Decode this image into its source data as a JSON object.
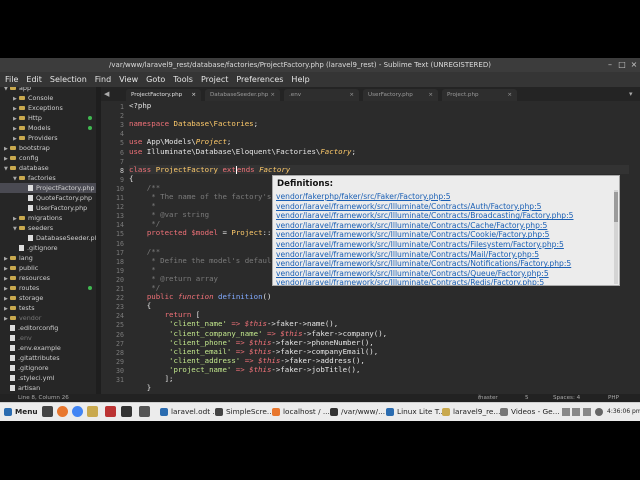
{
  "window": {
    "title": "/var/www/laravel9_rest/database/factories/ProjectFactory.php (laravel9_rest) - Sublime Text (UNREGISTERED)"
  },
  "menu": [
    "File",
    "Edit",
    "Selection",
    "Find",
    "View",
    "Goto",
    "Tools",
    "Project",
    "Preferences",
    "Help"
  ],
  "sidebar": {
    "items": [
      {
        "label": "app",
        "type": "folder",
        "depth": 1,
        "open": true
      },
      {
        "label": "Console",
        "type": "folder",
        "depth": 2,
        "open": false
      },
      {
        "label": "Exceptions",
        "type": "folder",
        "depth": 2,
        "open": false
      },
      {
        "label": "Http",
        "type": "folder",
        "depth": 2,
        "open": false,
        "dot": true
      },
      {
        "label": "Models",
        "type": "folder",
        "depth": 2,
        "open": false,
        "dot": true
      },
      {
        "label": "Providers",
        "type": "folder",
        "depth": 2,
        "open": false
      },
      {
        "label": "bootstrap",
        "type": "folder",
        "depth": 1,
        "open": false
      },
      {
        "label": "config",
        "type": "folder",
        "depth": 1,
        "open": false
      },
      {
        "label": "database",
        "type": "folder",
        "depth": 1,
        "open": true
      },
      {
        "label": "factories",
        "type": "folder",
        "depth": 2,
        "open": true
      },
      {
        "label": "ProjectFactory.php",
        "type": "file",
        "depth": 3,
        "active": true
      },
      {
        "label": "QuoteFactory.php",
        "type": "file",
        "depth": 3
      },
      {
        "label": "UserFactory.php",
        "type": "file",
        "depth": 3
      },
      {
        "label": "migrations",
        "type": "folder",
        "depth": 2,
        "open": false
      },
      {
        "label": "seeders",
        "type": "folder",
        "depth": 2,
        "open": true
      },
      {
        "label": "DatabaseSeeder.pl",
        "type": "file",
        "depth": 3
      },
      {
        "label": ".gitignore",
        "type": "file",
        "depth": 2
      },
      {
        "label": "lang",
        "type": "folder",
        "depth": 1,
        "open": false
      },
      {
        "label": "public",
        "type": "folder",
        "depth": 1,
        "open": false
      },
      {
        "label": "resources",
        "type": "folder",
        "depth": 1,
        "open": false
      },
      {
        "label": "routes",
        "type": "folder",
        "depth": 1,
        "open": false,
        "dot": true
      },
      {
        "label": "storage",
        "type": "folder",
        "depth": 1,
        "open": false
      },
      {
        "label": "tests",
        "type": "folder",
        "depth": 1,
        "open": false
      },
      {
        "label": "vendor",
        "type": "folder",
        "depth": 1,
        "open": false,
        "dim": true
      },
      {
        "label": ".editorconfig",
        "type": "file",
        "depth": 1
      },
      {
        "label": ".env",
        "type": "file",
        "depth": 1,
        "dim": true
      },
      {
        "label": ".env.example",
        "type": "file",
        "depth": 1
      },
      {
        "label": ".gitattributes",
        "type": "file",
        "depth": 1
      },
      {
        "label": ".gitignore",
        "type": "file",
        "depth": 1
      },
      {
        "label": ".styleci.yml",
        "type": "file",
        "depth": 1
      },
      {
        "label": "artisan",
        "type": "file",
        "depth": 1
      }
    ]
  },
  "tabs": [
    {
      "label": "ProjectFactory.php",
      "active": true
    },
    {
      "label": "DatabaseSeeder.php",
      "active": false
    },
    {
      "label": ".env",
      "active": false
    },
    {
      "label": "UserFactory.php",
      "active": false
    },
    {
      "label": "Project.php",
      "active": false
    }
  ],
  "editor": {
    "line_numbers": [
      "1",
      "2",
      "3",
      "4",
      "5",
      "6",
      "7",
      "8",
      "9",
      "10",
      "11",
      "12",
      "13",
      "14",
      "15",
      "16",
      "17",
      "18",
      "19",
      "20",
      "21",
      "22",
      "23",
      "24",
      "25",
      "26",
      "27",
      "28",
      "29",
      "30",
      "31"
    ],
    "current_line": 8,
    "lines": [
      [
        [
          "t",
          "<?php"
        ]
      ],
      [],
      [
        [
          "kw",
          "namespace"
        ],
        [
          "t",
          " "
        ],
        [
          "cls",
          "Database\\Factories"
        ],
        [
          "t",
          ";"
        ]
      ],
      [],
      [
        [
          "kw",
          "use"
        ],
        [
          "t",
          " App\\Models\\"
        ],
        [
          "cls it",
          "Project"
        ],
        [
          "t",
          ";"
        ]
      ],
      [
        [
          "kw",
          "use"
        ],
        [
          "t",
          " Illuminate\\Database\\Eloquent\\Factories\\"
        ],
        [
          "cls it",
          "Factory"
        ],
        [
          "t",
          ";"
        ]
      ],
      [],
      [
        [
          "kw",
          "class"
        ],
        [
          "t",
          " "
        ],
        [
          "cls",
          "ProjectFactory"
        ],
        [
          "t",
          " "
        ],
        [
          "kw",
          "ext"
        ],
        [
          "t",
          "|"
        ],
        [
          "kw",
          "ends"
        ],
        [
          "t",
          " "
        ],
        [
          "cls it",
          "Factory"
        ]
      ],
      [
        [
          "t",
          "{"
        ]
      ],
      [
        [
          "cmt",
          "    /**"
        ]
      ],
      [
        [
          "cmt",
          "     * The name of the factory's corresponding model."
        ]
      ],
      [
        [
          "cmt",
          "     *"
        ]
      ],
      [
        [
          "cmt",
          "     * @var string"
        ]
      ],
      [
        [
          "cmt",
          "     */"
        ]
      ],
      [
        [
          "t",
          "    "
        ],
        [
          "kw",
          "protected"
        ],
        [
          "t",
          " "
        ],
        [
          "var",
          "$model"
        ],
        [
          "t",
          " = "
        ],
        [
          "cls",
          "Project"
        ],
        [
          "t",
          "::class;"
        ]
      ],
      [],
      [
        [
          "cmt",
          "    /**"
        ]
      ],
      [
        [
          "cmt",
          "     * Define the model's default state."
        ]
      ],
      [
        [
          "cmt",
          "     *"
        ]
      ],
      [
        [
          "cmt",
          "     * @return array"
        ]
      ],
      [
        [
          "cmt",
          "     */"
        ]
      ],
      [
        [
          "t",
          "    "
        ],
        [
          "kw",
          "public"
        ],
        [
          "t",
          " "
        ],
        [
          "kw it",
          "function"
        ],
        [
          "t",
          " "
        ],
        [
          "fn",
          "definition"
        ],
        [
          "t",
          "()"
        ]
      ],
      [
        [
          "t",
          "    {"
        ]
      ],
      [
        [
          "t",
          "        "
        ],
        [
          "kw",
          "return"
        ],
        [
          "t",
          " ["
        ]
      ],
      [
        [
          "t",
          "         "
        ],
        [
          "str",
          "'client_name'"
        ],
        [
          "t",
          " "
        ],
        [
          "kw",
          "=>"
        ],
        [
          "t",
          " "
        ],
        [
          "var it",
          "$this"
        ],
        [
          "t",
          "->faker->name(),"
        ]
      ],
      [
        [
          "t",
          "         "
        ],
        [
          "str",
          "'client_company_name'"
        ],
        [
          "t",
          " "
        ],
        [
          "kw",
          "=>"
        ],
        [
          "t",
          " "
        ],
        [
          "var it",
          "$this"
        ],
        [
          "t",
          "->faker->company(),"
        ]
      ],
      [
        [
          "t",
          "         "
        ],
        [
          "str",
          "'client_phone'"
        ],
        [
          "t",
          " "
        ],
        [
          "kw",
          "=>"
        ],
        [
          "t",
          " "
        ],
        [
          "var it",
          "$this"
        ],
        [
          "t",
          "->faker->phoneNumber(),"
        ]
      ],
      [
        [
          "t",
          "         "
        ],
        [
          "str",
          "'client_email'"
        ],
        [
          "t",
          " "
        ],
        [
          "kw",
          "=>"
        ],
        [
          "t",
          " "
        ],
        [
          "var it",
          "$this"
        ],
        [
          "t",
          "->faker->companyEmail(),"
        ]
      ],
      [
        [
          "t",
          "         "
        ],
        [
          "str",
          "'client_address'"
        ],
        [
          "t",
          " "
        ],
        [
          "kw",
          "=>"
        ],
        [
          "t",
          " "
        ],
        [
          "var it",
          "$this"
        ],
        [
          "t",
          "->faker->address(),"
        ]
      ],
      [
        [
          "t",
          "         "
        ],
        [
          "str",
          "'project_name'"
        ],
        [
          "t",
          " "
        ],
        [
          "kw",
          "=>"
        ],
        [
          "t",
          " "
        ],
        [
          "var it",
          "$this"
        ],
        [
          "t",
          "->faker->jobTitle(),"
        ]
      ],
      [
        [
          "t",
          "        ];"
        ]
      ],
      [
        [
          "t",
          "    }"
        ]
      ]
    ]
  },
  "popup": {
    "title": "Definitions:",
    "links": [
      "vendor/fakerphp/faker/src/Faker/Factory.php:5",
      "vendor/laravel/framework/src/Illuminate/Contracts/Auth/Factory.php:5",
      "vendor/laravel/framework/src/Illuminate/Contracts/Broadcasting/Factory.php:5",
      "vendor/laravel/framework/src/Illuminate/Contracts/Cache/Factory.php:5",
      "vendor/laravel/framework/src/Illuminate/Contracts/Cookie/Factory.php:5",
      "vendor/laravel/framework/src/Illuminate/Contracts/Filesystem/Factory.php:5",
      "vendor/laravel/framework/src/Illuminate/Contracts/Mail/Factory.php:5",
      "vendor/laravel/framework/src/Illuminate/Contracts/Notifications/Factory.php:5",
      "vendor/laravel/framework/src/Illuminate/Contracts/Queue/Factory.php:5",
      "vendor/laravel/framework/src/Illuminate/Contracts/Redis/Factory.php:5"
    ]
  },
  "status": {
    "position": "Line 8, Column 26",
    "git": "master",
    "git_count": "5",
    "spaces": "Spaces: 4",
    "syntax": "PHP"
  },
  "taskbar": {
    "menu_label": "Menu",
    "items": [
      "laravel.odt ...",
      "SimpleScre...",
      "localhost / ...",
      "/var/www/...",
      "Linux Lite T...",
      "laravel9_re...",
      "Videos - Ge..."
    ],
    "clock": "4:36:06 pm"
  },
  "colors": {
    "editor_bg": "#2b2b2b",
    "sidebar_bg": "#262626",
    "keyword": "#f07178",
    "string": "#c3e88d",
    "class": "#ffcb6b",
    "function": "#82aaff",
    "comment": "#7b7b7b",
    "link": "#1a5fb4"
  }
}
